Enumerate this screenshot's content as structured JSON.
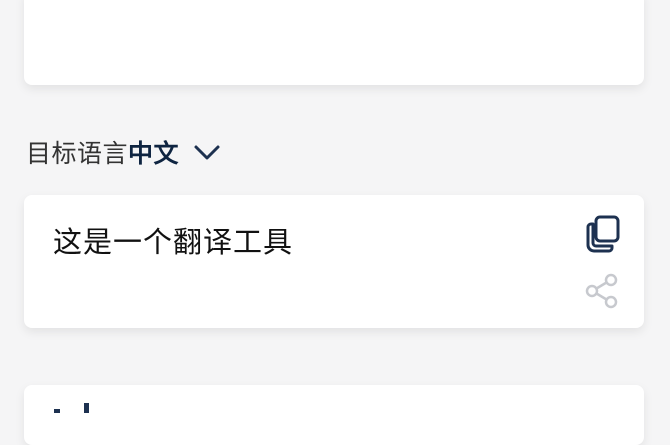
{
  "source_panel": {
    "text": ""
  },
  "target_language": {
    "label": "目标语言",
    "value": "中文",
    "icon": "chevron-down-icon"
  },
  "result_panel": {
    "text": "这是一个翻译工具",
    "copy_icon": "copy-icon",
    "share_icon": "share-icon"
  },
  "colors": {
    "background": "#f5f5f6",
    "card": "#ffffff",
    "accent": "#0e2441",
    "icon": "#1d3150",
    "icon_muted": "#c7c9ce"
  }
}
